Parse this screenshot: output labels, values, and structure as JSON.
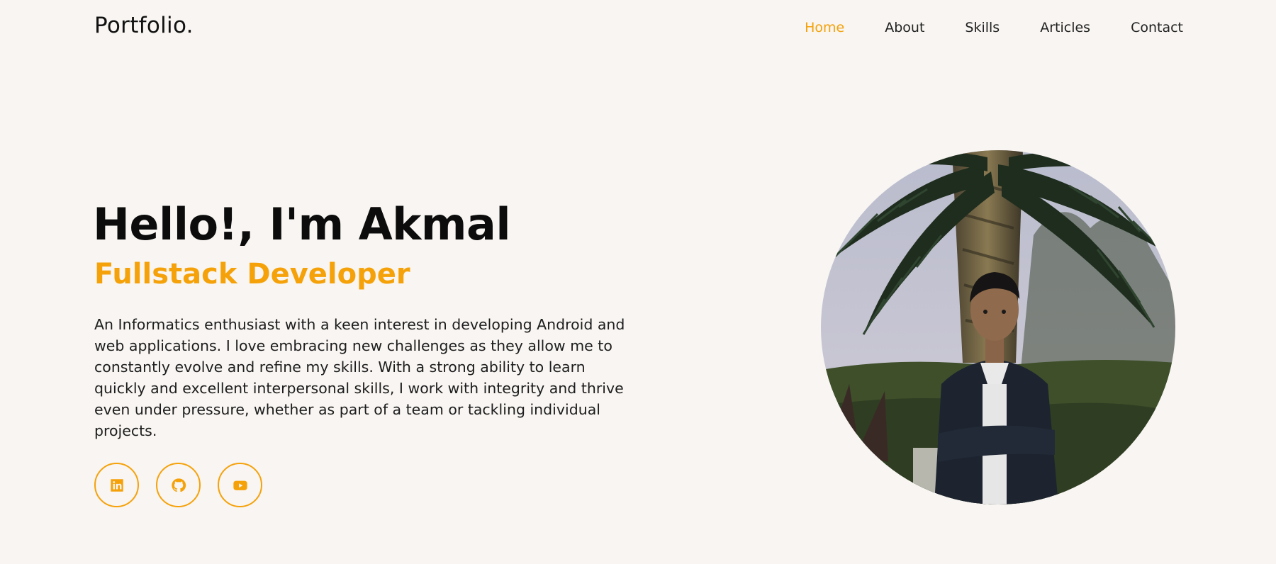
{
  "header": {
    "logo": "Portfolio.",
    "nav": [
      {
        "label": "Home",
        "active": true
      },
      {
        "label": "About",
        "active": false
      },
      {
        "label": "Skills",
        "active": false
      },
      {
        "label": "Articles",
        "active": false
      },
      {
        "label": "Contact",
        "active": false
      }
    ]
  },
  "hero": {
    "title": "Hello!, I'm Akmal",
    "subtitle": "Fullstack Developer",
    "description": "An Informatics enthusiast with a keen interest in developing Android and web applications. I love embracing new challenges as they allow me to constantly evolve and refine my skills. With a strong ability to learn quickly and excellent interpersonal skills, I work with integrity and thrive even under pressure, whether as part of a team or tackling individual projects."
  },
  "socials": [
    {
      "icon": "linkedin-icon"
    },
    {
      "icon": "github-icon"
    },
    {
      "icon": "youtube-icon"
    }
  ],
  "photo": {
    "subject": "profile-photo"
  },
  "colors": {
    "accent": "#f5a20a",
    "background": "#f8f5f2",
    "text": "#111111"
  }
}
